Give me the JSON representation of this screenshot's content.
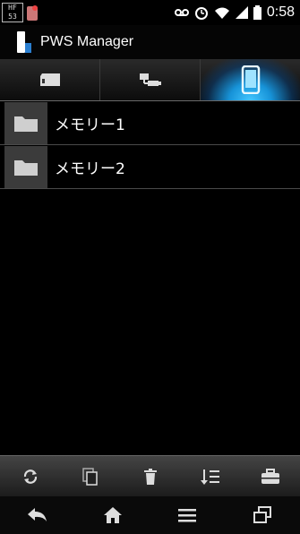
{
  "status_bar": {
    "badge_top": "HF",
    "badge_bottom": "53",
    "time": "0:58",
    "icons": [
      "voicemail-icon",
      "alarm-icon",
      "wifi-icon",
      "signal-icon",
      "battery-icon"
    ]
  },
  "app": {
    "title": "PWS Manager"
  },
  "tabs": [
    {
      "icon": "sd-card-icon",
      "active": false
    },
    {
      "icon": "usb-icon",
      "active": false
    },
    {
      "icon": "phone-icon",
      "active": true
    }
  ],
  "list": {
    "items": [
      {
        "label": "メモリー1",
        "icon": "folder-icon"
      },
      {
        "label": "メモリー2",
        "icon": "folder-icon"
      }
    ]
  },
  "toolbar": {
    "buttons": [
      "refresh-icon",
      "copy-icon",
      "delete-icon",
      "sort-icon",
      "toolbox-icon"
    ]
  },
  "navbar": {
    "buttons": [
      "back-icon",
      "home-icon",
      "menu-icon",
      "recent-apps-icon"
    ]
  },
  "colors": {
    "accent": "#1793d8",
    "background": "#000000"
  }
}
